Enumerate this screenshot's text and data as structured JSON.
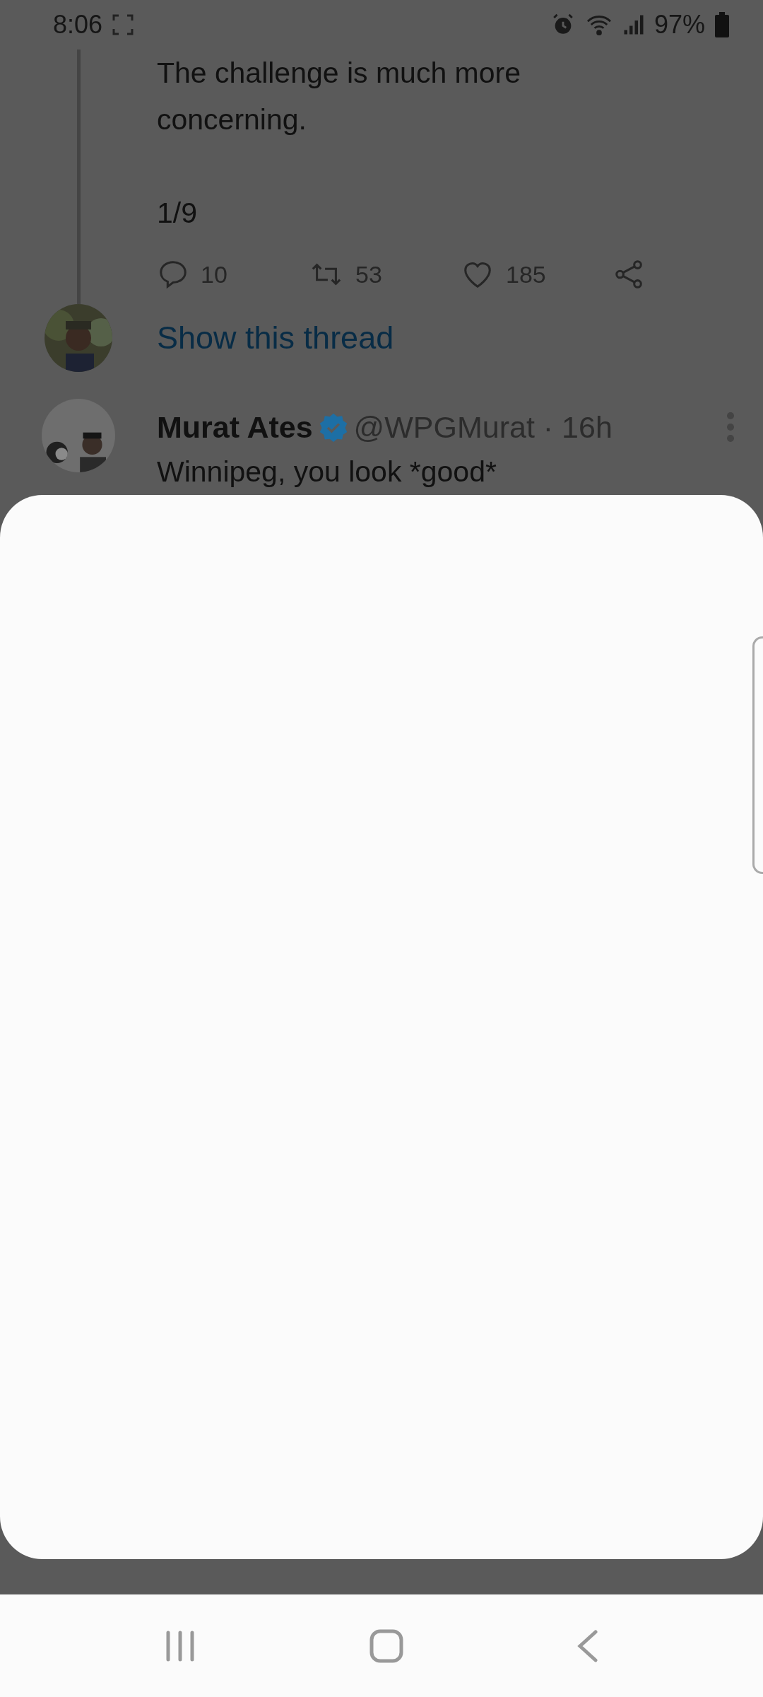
{
  "status_bar": {
    "time": "8:06",
    "battery": "97%"
  },
  "thread_tweet": {
    "text": "The challenge is much more concerning.",
    "counter": "1/9",
    "actions": [
      {
        "kind": "reply",
        "count": "10"
      },
      {
        "kind": "retweet",
        "count": "53"
      },
      {
        "kind": "like",
        "count": "185"
      },
      {
        "kind": "share"
      }
    ],
    "show_thread": "Show this thread"
  },
  "next_tweet": {
    "name": "Murat Ates",
    "verified": true,
    "meta": "@WPGMurat · 16h",
    "text": "Winnipeg, you look *good*"
  }
}
